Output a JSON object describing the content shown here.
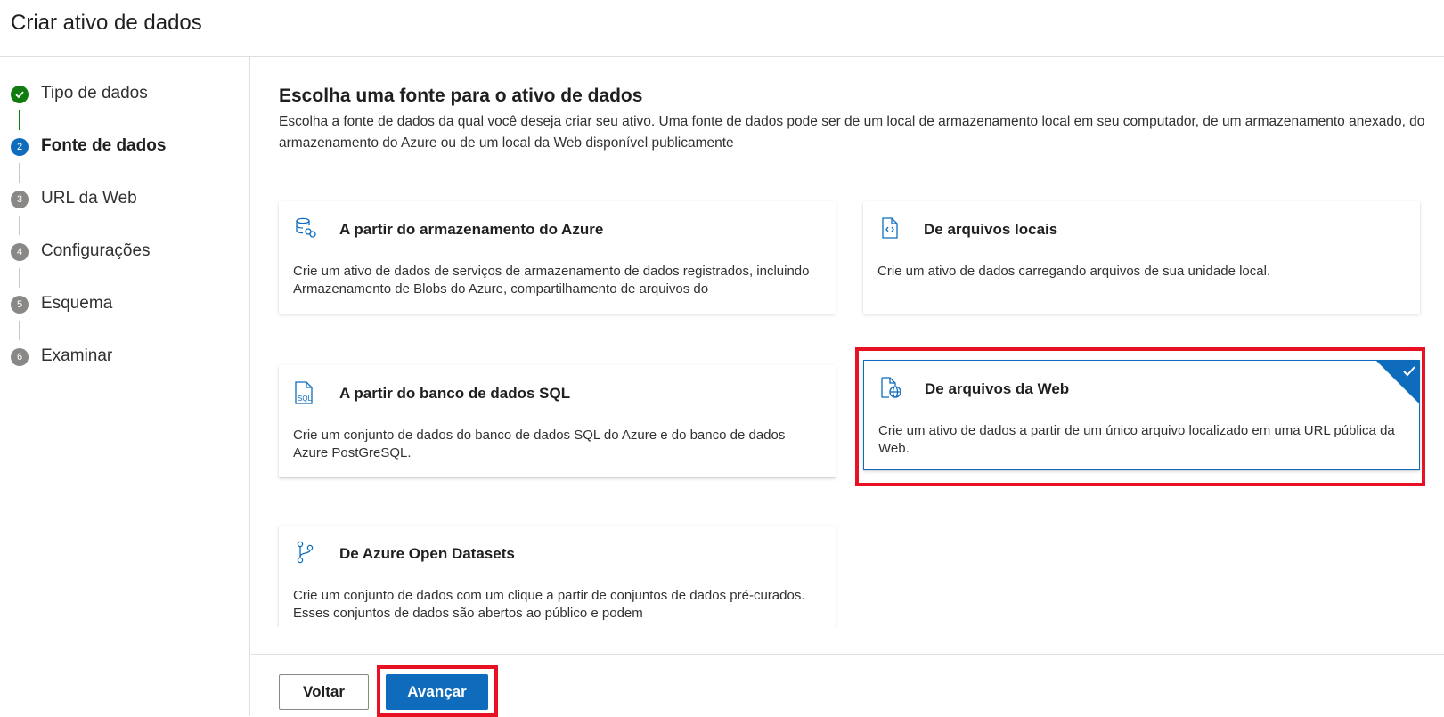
{
  "header": {
    "title": "Criar ativo de dados"
  },
  "steps": [
    {
      "number": "",
      "label": "Tipo de dados",
      "status": "completed"
    },
    {
      "number": "2",
      "label": "Fonte de dados",
      "status": "current"
    },
    {
      "number": "3",
      "label": "URL da Web",
      "status": "pending"
    },
    {
      "number": "4",
      "label": "Configurações",
      "status": "pending"
    },
    {
      "number": "5",
      "label": "Esquema",
      "status": "pending"
    },
    {
      "number": "6",
      "label": "Examinar",
      "status": "pending"
    }
  ],
  "main": {
    "title": "Escolha uma fonte para o ativo de dados",
    "description": "Escolha a fonte de dados da qual você deseja criar seu ativo. Uma fonte de dados pode ser de um local de armazenamento local em seu computador, de um armazenamento anexado, do armazenamento do Azure ou de um local da Web disponível publicamente",
    "cards": [
      {
        "icon": "azure-storage-icon",
        "title": "A partir do armazenamento do Azure",
        "description": "Crie um ativo de dados de serviços de armazenamento de dados registrados, incluindo Armazenamento de Blobs do Azure, compartilhamento de arquivos do",
        "selected": false
      },
      {
        "icon": "local-files-icon",
        "title": "De arquivos locais",
        "description": "Crie um ativo de dados carregando arquivos de sua unidade local.",
        "selected": false
      },
      {
        "icon": "sql-database-icon",
        "title": "A partir do banco de dados SQL",
        "description": "Crie um conjunto de dados do banco de dados SQL do Azure e do banco de dados Azure PostGreSQL.",
        "selected": false
      },
      {
        "icon": "web-files-icon",
        "title": "De arquivos da Web",
        "description": "Crie um ativo de dados a partir de um único arquivo localizado em uma URL pública da Web.",
        "selected": true
      },
      {
        "icon": "open-datasets-icon",
        "title": "De Azure Open Datasets",
        "description": "Crie um conjunto de dados com um clique a partir de conjuntos de dados pré-curados. Esses conjuntos de dados são abertos ao público e podem",
        "selected": false
      }
    ]
  },
  "footer": {
    "back_label": "Voltar",
    "next_label": "Avançar"
  },
  "colors": {
    "accent": "#0f6cbd",
    "success": "#107c10",
    "highlight": "#e81123"
  }
}
